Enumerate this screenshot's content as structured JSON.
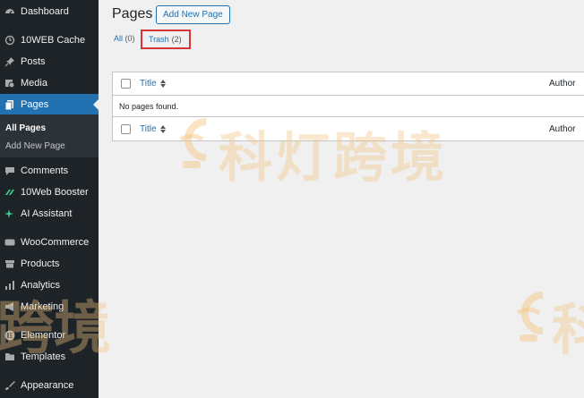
{
  "sidebar": {
    "items": [
      {
        "label": "Dashboard",
        "icon": "dashboard-icon"
      },
      {
        "label": "10WEB Cache",
        "icon": "cache-icon"
      },
      {
        "label": "Posts",
        "icon": "pin-icon"
      },
      {
        "label": "Media",
        "icon": "media-icon"
      },
      {
        "label": "Pages",
        "icon": "pages-icon"
      },
      {
        "label": "Comments",
        "icon": "comment-icon"
      },
      {
        "label": "10Web Booster",
        "icon": "booster-icon"
      },
      {
        "label": "AI Assistant",
        "icon": "sparkle-icon"
      },
      {
        "label": "WooCommerce",
        "icon": "woocommerce-icon"
      },
      {
        "label": "Products",
        "icon": "archive-icon"
      },
      {
        "label": "Analytics",
        "icon": "bar-chart-icon"
      },
      {
        "label": "Marketing",
        "icon": "megaphone-icon"
      },
      {
        "label": "Elementor",
        "icon": "elementor-icon"
      },
      {
        "label": "Templates",
        "icon": "folder-icon"
      },
      {
        "label": "Appearance",
        "icon": "brush-icon"
      }
    ],
    "submenu": [
      "All Pages",
      "Add New Page"
    ]
  },
  "main": {
    "title": "Pages",
    "add_new_label": "Add New Page",
    "filters": {
      "all_label": "All",
      "all_count": "(0)",
      "trash_label": "Trash",
      "trash_count": "(2)"
    },
    "table": {
      "col_title": "Title",
      "col_author": "Author",
      "empty_message": "No pages found."
    }
  },
  "watermark": {
    "text_full": "科灯跨境",
    "text_part1": "跨境",
    "text_part2": "科"
  },
  "colors": {
    "sidebar_bg": "#1d2327",
    "accent": "#2271b1",
    "highlight_border": "#d63638"
  }
}
